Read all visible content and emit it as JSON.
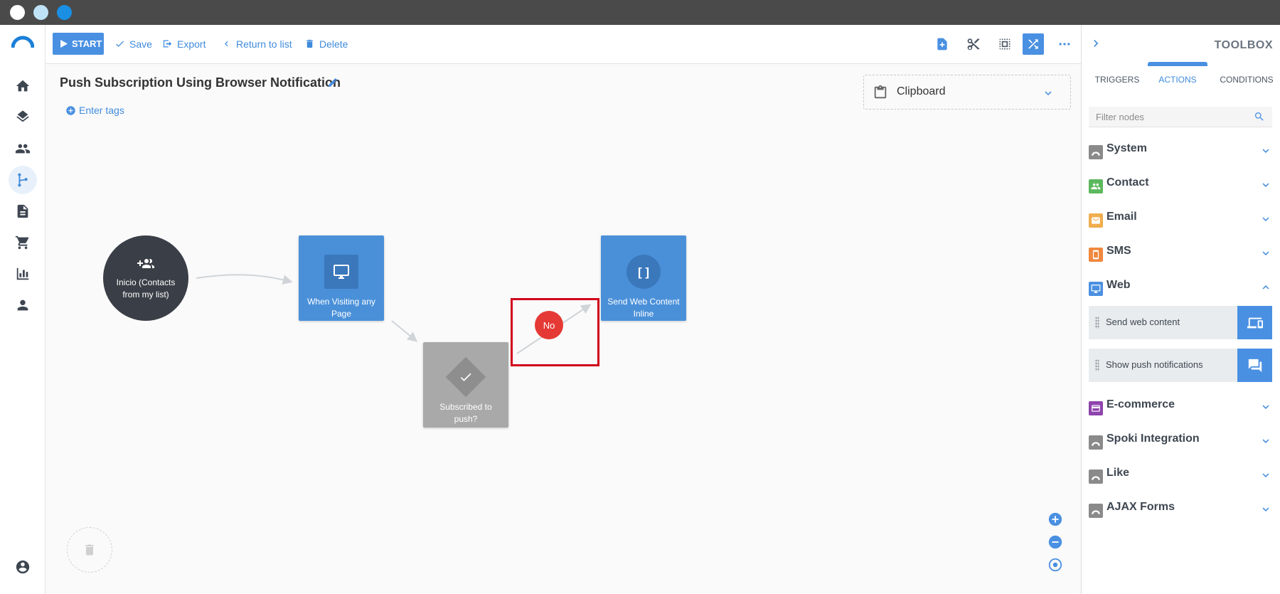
{
  "toolbar": {
    "start_label": "START",
    "save_label": "Save",
    "export_label": "Export",
    "return_label": "Return to list",
    "delete_label": "Delete"
  },
  "workflow": {
    "title": "Push Subscription Using Browser Notification",
    "tags_label": "Enter tags",
    "clipboard_label": "Clipboard"
  },
  "nodes": {
    "inicio": "Inicio (Contacts from my list)",
    "visit": "When Visiting any Page",
    "condition": "Subscribed to push?",
    "send": "Send Web Content Inline",
    "send_glyph": "[ ]",
    "no_label": "No"
  },
  "toolbox": {
    "title": "TOOLBOX",
    "tabs": [
      "TRIGGERS",
      "ACTIONS",
      "CONDITIONS"
    ],
    "active_tab": "ACTIONS",
    "filter_placeholder": "Filter nodes",
    "categories": [
      {
        "label": "System",
        "color": "#8a8a8a",
        "icon": "cloud-icon"
      },
      {
        "label": "Contact",
        "color": "#5cb85c",
        "icon": "people-icon"
      },
      {
        "label": "Email",
        "color": "#f0ad4e",
        "icon": "envelope-icon"
      },
      {
        "label": "SMS",
        "color": "#f0883e",
        "icon": "phone-icon"
      },
      {
        "label": "Web",
        "color": "#4a90e2",
        "icon": "monitor-icon",
        "expanded": true
      },
      {
        "label": "E-commerce",
        "color": "#8e44ad",
        "icon": "card-icon"
      },
      {
        "label": "Spoki Integration",
        "color": "#8a8a8a",
        "icon": "cloud-icon"
      },
      {
        "label": "Like",
        "color": "#8a8a8a",
        "icon": "cloud-icon"
      },
      {
        "label": "AJAX Forms",
        "color": "#8a8a8a",
        "icon": "cloud-icon"
      }
    ],
    "web_items": [
      {
        "label": "Send web content",
        "icon": "devices-icon"
      },
      {
        "label": "Show push notifications",
        "icon": "chat-icon"
      }
    ]
  },
  "colors": {
    "accent": "#4a90e2",
    "dark_node": "#3a3f47",
    "condition_node": "#a9a9a9",
    "no_badge": "#e53935",
    "highlight": "#d0021b"
  }
}
